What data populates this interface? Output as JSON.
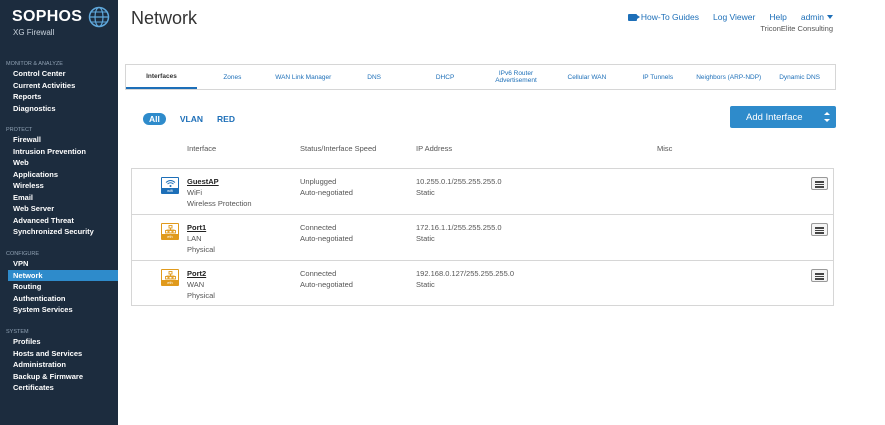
{
  "brand": {
    "name": "SOPHOS",
    "product": "XG Firewall"
  },
  "sidebar": {
    "sections": [
      {
        "title": "MONITOR & ANALYZE",
        "items": [
          "Control Center",
          "Current Activities",
          "Reports",
          "Diagnostics"
        ]
      },
      {
        "title": "PROTECT",
        "items": [
          "Firewall",
          "Intrusion Prevention",
          "Web",
          "Applications",
          "Wireless",
          "Email",
          "Web Server",
          "Advanced Threat",
          "Synchronized Security"
        ]
      },
      {
        "title": "CONFIGURE",
        "items": [
          "VPN",
          "Network",
          "Routing",
          "Authentication",
          "System Services"
        ]
      },
      {
        "title": "SYSTEM",
        "items": [
          "Profiles",
          "Hosts and Services",
          "Administration",
          "Backup & Firmware",
          "Certificates"
        ]
      }
    ],
    "active_item": "Network"
  },
  "header": {
    "title": "Network",
    "links": {
      "howto": "How-To Guides",
      "logviewer": "Log Viewer",
      "help": "Help",
      "admin": "admin"
    },
    "organization": "TriconElite Consulting"
  },
  "tabs": [
    "Interfaces",
    "Zones",
    "WAN Link Manager",
    "DNS",
    "DHCP",
    "IPv6 Router Advertisement",
    "Cellular WAN",
    "IP Tunnels",
    "Neighbors (ARP-NDP)",
    "Dynamic DNS"
  ],
  "active_tab": "Interfaces",
  "filters": [
    "All",
    "VLAN",
    "RED"
  ],
  "active_filter": "All",
  "add_button": "Add Interface",
  "table": {
    "headers": {
      "interface": "Interface",
      "status": "Status/Interface Speed",
      "ip": "IP Address",
      "misc": "Misc"
    },
    "rows": [
      {
        "icon": "wifi-icon",
        "icon_label": "wifi",
        "name": "GuestAP",
        "type": "WiFi",
        "zone": "Wireless Protection",
        "status": "Unplugged",
        "speed": "Auto-negotiated",
        "ip": "10.255.0.1/255.255.255.0",
        "mode": "Static"
      },
      {
        "icon": "ethernet-icon",
        "icon_label": "eth",
        "name": "Port1",
        "type": "LAN",
        "zone": "Physical",
        "status": "Connected",
        "speed": "Auto-negotiated",
        "ip": "172.16.1.1/255.255.255.0",
        "mode": "Static"
      },
      {
        "icon": "ethernet-icon",
        "icon_label": "eth",
        "name": "Port2",
        "type": "WAN",
        "zone": "Physical",
        "status": "Connected",
        "speed": "Auto-negotiated",
        "ip": "192.168.0.127/255.255.255.0",
        "mode": "Static"
      }
    ]
  },
  "colors": {
    "sidebar_bg": "#1c2c3e",
    "accent": "#2e8bcb",
    "link": "#1d6fb8",
    "eth_orange": "#e09a1c"
  }
}
